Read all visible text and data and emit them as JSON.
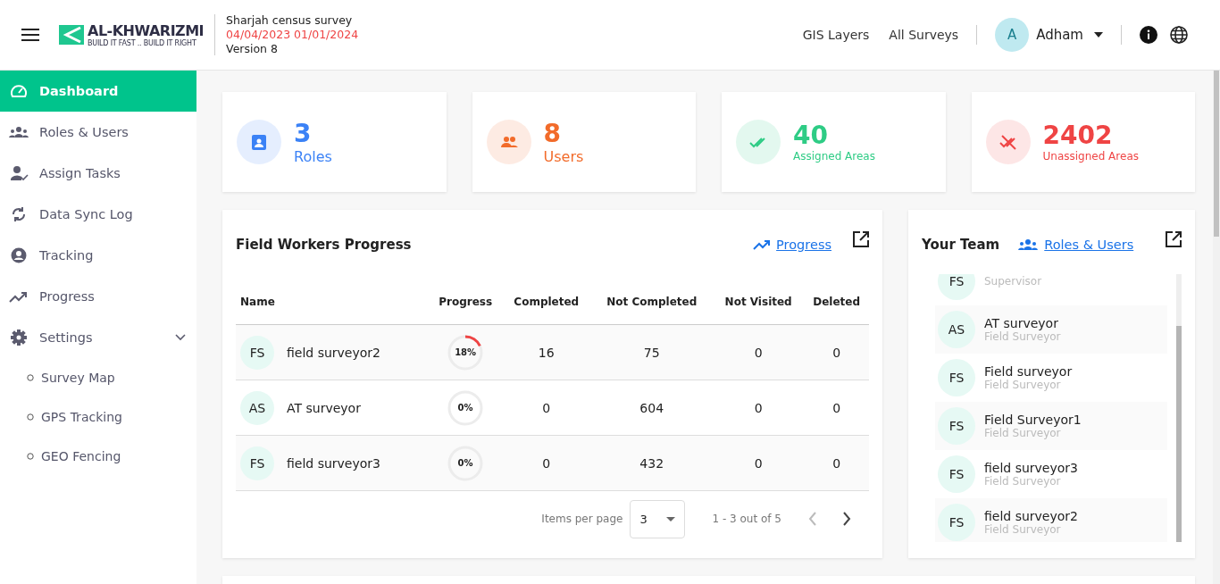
{
  "header": {
    "brand": {
      "name": "AL-KHWARIZMI",
      "tagline": "BUILD IT FAST .. BUILD IT RIGHT"
    },
    "survey": {
      "title": "Sharjah census survey",
      "dates": "04/04/2023 01/01/2024",
      "version": "Version 8"
    },
    "links": [
      "GIS Layers",
      "All Surveys"
    ],
    "user": {
      "initial": "A",
      "name": "Adham"
    }
  },
  "sidebar": {
    "items": [
      {
        "label": "Dashboard",
        "selected": true
      },
      {
        "label": "Roles & Users",
        "selected": false
      },
      {
        "label": "Assign Tasks",
        "selected": false
      },
      {
        "label": "Data Sync Log",
        "selected": false
      },
      {
        "label": "Tracking",
        "selected": false
      },
      {
        "label": "Progress",
        "selected": false
      },
      {
        "label": "Settings",
        "selected": false,
        "expanded": true,
        "children": [
          {
            "label": "Survey Map",
            "selected": false
          },
          {
            "label": "GPS Tracking",
            "selected": false
          },
          {
            "label": "GEO Fencing",
            "selected": false
          }
        ]
      }
    ]
  },
  "stats": [
    {
      "value": "3",
      "label": "Roles",
      "color": "#3b82f6"
    },
    {
      "value": "8",
      "label": "Users",
      "color": "#f26b2a"
    },
    {
      "value": "40",
      "label": "Assigned Areas",
      "color": "#2ecc85"
    },
    {
      "value": "2402",
      "label": "Unassigned Areas",
      "color": "#ef4444"
    }
  ],
  "progress_panel": {
    "title": "Field Workers Progress",
    "link": "Progress",
    "columns": [
      "Name",
      "Progress",
      "Completed",
      "Not Completed",
      "Not Visited",
      "Deleted"
    ],
    "rows": [
      {
        "initials": "FS",
        "name": "field surveyor2",
        "level": 0.18,
        "percent": "18%",
        "completed": "16",
        "not_completed": "75",
        "not_visited": "0",
        "deleted": "0"
      },
      {
        "initials": "AS",
        "name": "AT surveyor",
        "level": 0,
        "percent": "0%",
        "completed": "0",
        "not_completed": "604",
        "not_visited": "0",
        "deleted": "0"
      },
      {
        "initials": "FS",
        "name": "field surveyor3",
        "level": 0,
        "percent": "0%",
        "completed": "0",
        "not_completed": "432",
        "not_visited": "0",
        "deleted": "0"
      }
    ],
    "pagination": {
      "items_label": "Items per page",
      "page_size": "3",
      "range": "1 - 3 out of 5"
    }
  },
  "team_panel": {
    "title": "Your Team",
    "link": "Roles & Users",
    "members": [
      {
        "initials": "FS",
        "role": "Supervisor"
      },
      {
        "initials": "AS",
        "name": "AT surveyor",
        "role": "Field Surveyor"
      },
      {
        "initials": "FS",
        "name": "Field surveyor",
        "role": "Field Surveyor"
      },
      {
        "initials": "FS",
        "name": "Field Surveyor1",
        "role": "Field Surveyor"
      },
      {
        "initials": "FS",
        "name": "field surveyor3",
        "role": "Field Surveyor"
      },
      {
        "initials": "FS",
        "name": "field surveyor2",
        "role": "Field Surveyor"
      }
    ]
  }
}
